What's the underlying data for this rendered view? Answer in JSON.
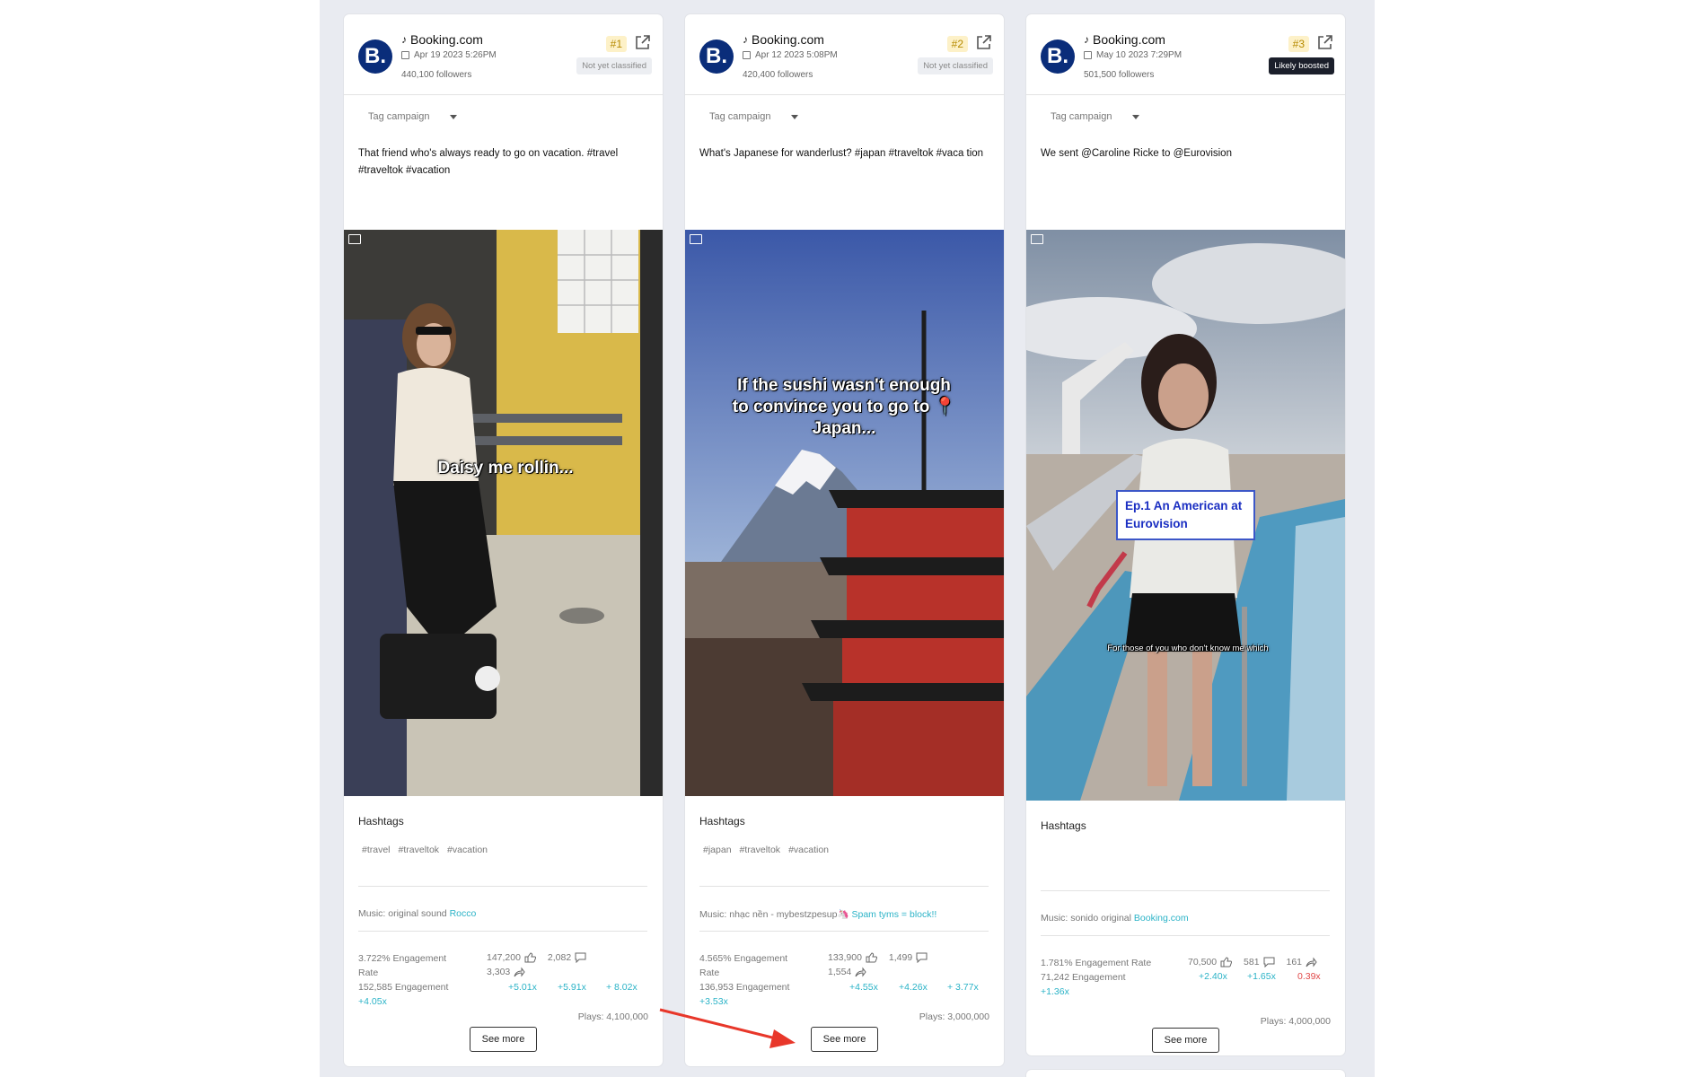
{
  "cards": [
    {
      "brand": "Booking.com",
      "date": "Apr 19 2023 5:26PM",
      "followers": "440,100 followers",
      "rank": "#1",
      "status": "Not yet classified",
      "tag_campaign": "Tag campaign",
      "caption": "That friend who's always ready to go on vacation. #travel #traveltok #vacation",
      "overlay": "Daisy me rollin...",
      "hashtags_title": "Hashtags",
      "hashtags": [
        "#travel",
        "#traveltok",
        "#vacation"
      ],
      "music_prefix": "Music: original sound",
      "music_link": "Rocco",
      "engagement_rate": "3.722% Engagement",
      "engagement_rate_2": "Rate",
      "engagements": "152,585 Engagement",
      "engagements_mult": "+4.05x",
      "likes": "147,200",
      "comments": "2,082",
      "shares": "3,303",
      "mult_likes": "+5.01x",
      "mult_comments": "+5.91x",
      "mult_shares": "+ 8.02x",
      "plays": "Plays: 4,100,000",
      "see_more": "See more"
    },
    {
      "brand": "Booking.com",
      "date": "Apr 12 2023 5:08PM",
      "followers": "420,400 followers",
      "rank": "#2",
      "status": "Not yet classified",
      "tag_campaign": "Tag campaign",
      "caption": "What's Japanese for wanderlust? #japan #traveltok #vaca tion",
      "overlay": "If the sushi wasn't enough to convince you to go to 📍Japan...",
      "hashtags_title": "Hashtags",
      "hashtags": [
        "#japan",
        "#traveltok",
        "#vacation"
      ],
      "music_prefix": "Music: nhạc nền - mybestzpesup",
      "music_link": "Spam tyms = block!!",
      "engagement_rate": "4.565% Engagement",
      "engagement_rate_2": "Rate",
      "engagements": "136,953 Engagement",
      "engagements_mult": "+3.53x",
      "likes": "133,900",
      "comments": "1,499",
      "shares": "1,554",
      "mult_likes": "+4.55x",
      "mult_comments": "+4.26x",
      "mult_shares": "+ 3.77x",
      "plays": "Plays: 3,000,000",
      "see_more": "See more"
    },
    {
      "brand": "Booking.com",
      "date": "May 10 2023 7:29PM",
      "followers": "501,500 followers",
      "rank": "#3",
      "status": "Likely boosted",
      "tag_campaign": "Tag campaign",
      "caption": "We sent @Caroline Ricke to @Eurovision",
      "overlay": "Ep.1 An American at Eurovision",
      "overlay_sub": "For those of you who don't know me which",
      "hashtags_title": "Hashtags",
      "hashtags": [],
      "music_prefix": "Music: sonido original",
      "music_link": "Booking.com",
      "engagement_rate": "1.781% Engagement Rate",
      "engagements": "71,242 Engagement",
      "engagements_mult": "+1.36x",
      "likes": "70,500",
      "comments": "581",
      "shares": "161",
      "mult_likes": "+2.40x",
      "mult_comments": "+1.65x",
      "mult_shares": "0.39x",
      "plays": "Plays: 4,000,000",
      "see_more": "See more"
    }
  ],
  "colors": {
    "brand_logo": "#0a2d7a",
    "accent_teal": "#2bb3c7",
    "negative_red": "#e04848",
    "annotation_arrow": "#e8372a"
  }
}
